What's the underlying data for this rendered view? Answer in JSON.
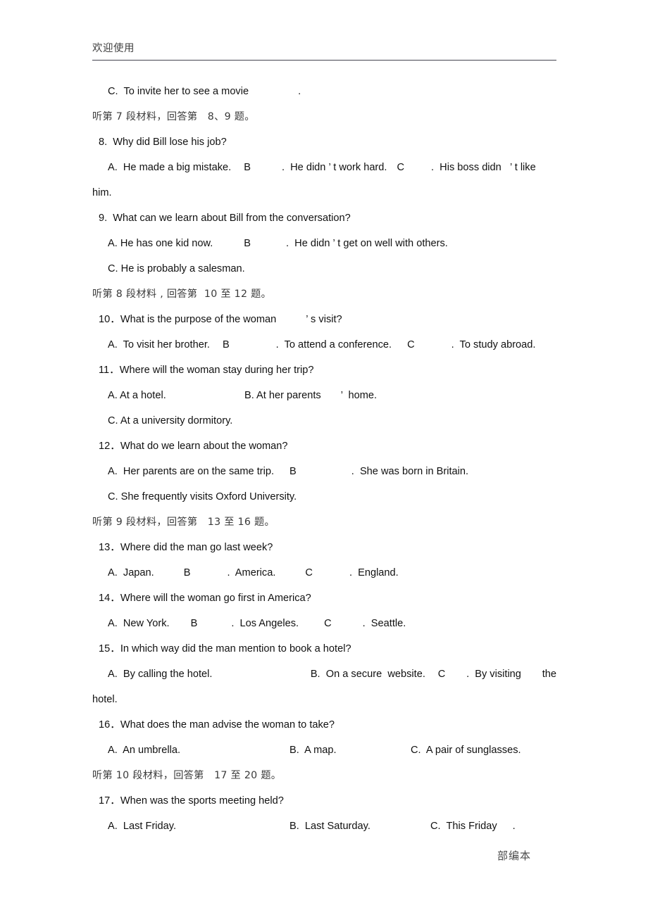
{
  "header": {
    "title": "欢迎使用"
  },
  "footer": {
    "watermark": "部编本"
  },
  "body": {
    "line_01": "C.  To invite her to see a movie",
    "line_01_tail": ".",
    "line_02": "听第 7 段材料，回答第   8、9 题。",
    "line_03": "8.  Why did Bill lose his job?",
    "line_04_a": "A.  He made a big mistake.",
    "line_04_b": "B",
    "line_04_b2": ".  He didn ’ t work hard.",
    "line_04_c": "C",
    "line_04_c2": ".  His boss didn   ’ t like",
    "line_05": "him.",
    "line_06": "9.  What can we learn about Bill from the conversation?",
    "line_07_a": "A. He has one kid now.",
    "line_07_b": "B",
    "line_07_b2": ".  He didn ’ t get on well with others.",
    "line_08": "C. He is probably a salesman.",
    "line_09": "听第 8 段材料 , 回答第  10 至 12 题。",
    "line_10": "10．What is the purpose of the woman",
    "line_10_tail": "’ s visit?",
    "line_11_a": "A.  To visit her brother.",
    "line_11_b": "B",
    "line_11_b2": ".  To attend a conference.",
    "line_11_c": "C",
    "line_11_c2": ".  To study abroad.",
    "line_12": "11．Where will the woman stay during her trip?",
    "line_13_a": "A. At a hotel.",
    "line_13_b": "B. At her parents",
    "line_13_b2": "’  home.",
    "line_14": "C. At a university dormitory.",
    "line_15": "12．What do we learn about the woman?",
    "line_16_a": "A.  Her parents are on the same trip.",
    "line_16_b": "B",
    "line_16_b2": ".  She was born in Britain.",
    "line_17": "C. She frequently visits Oxford University.",
    "line_18": "听第 9 段材料，回答第   13 至 16 题。",
    "line_19": "13．Where did the man go last week?",
    "line_20_a": "A.  Japan.",
    "line_20_b": "B",
    "line_20_b2": ".  America.",
    "line_20_c": "C",
    "line_20_c2": ".  England.",
    "line_21": "14．Where will the woman go first in America?",
    "line_22_a": "A.  New York.",
    "line_22_b": "B",
    "line_22_b2": ".  Los Angeles.",
    "line_22_c": "C",
    "line_22_c2": ".  Seattle.",
    "line_23": "15．In which way did the man mention to book a hotel?",
    "line_24_a": "A.  By calling the hotel.",
    "line_24_b": "B.  On a secure  website.",
    "line_24_c": "C",
    "line_24_c2": ".  By visiting",
    "line_24_d": "the",
    "line_25": "hotel.",
    "line_26": "16．What does the man advise the woman to take?",
    "line_27_a": "A.  An umbrella.",
    "line_27_b": "B.  A map.",
    "line_27_c": "C.  A pair of sunglasses.",
    "line_28": "听第 10 段材料，回答第   17 至 20 题。",
    "line_29": "17．When was the sports meeting held?",
    "line_30_a": "A.  Last Friday.",
    "line_30_b": "B.  Last Saturday.",
    "line_30_c": "C.  This Friday",
    "line_30_c2": "."
  }
}
